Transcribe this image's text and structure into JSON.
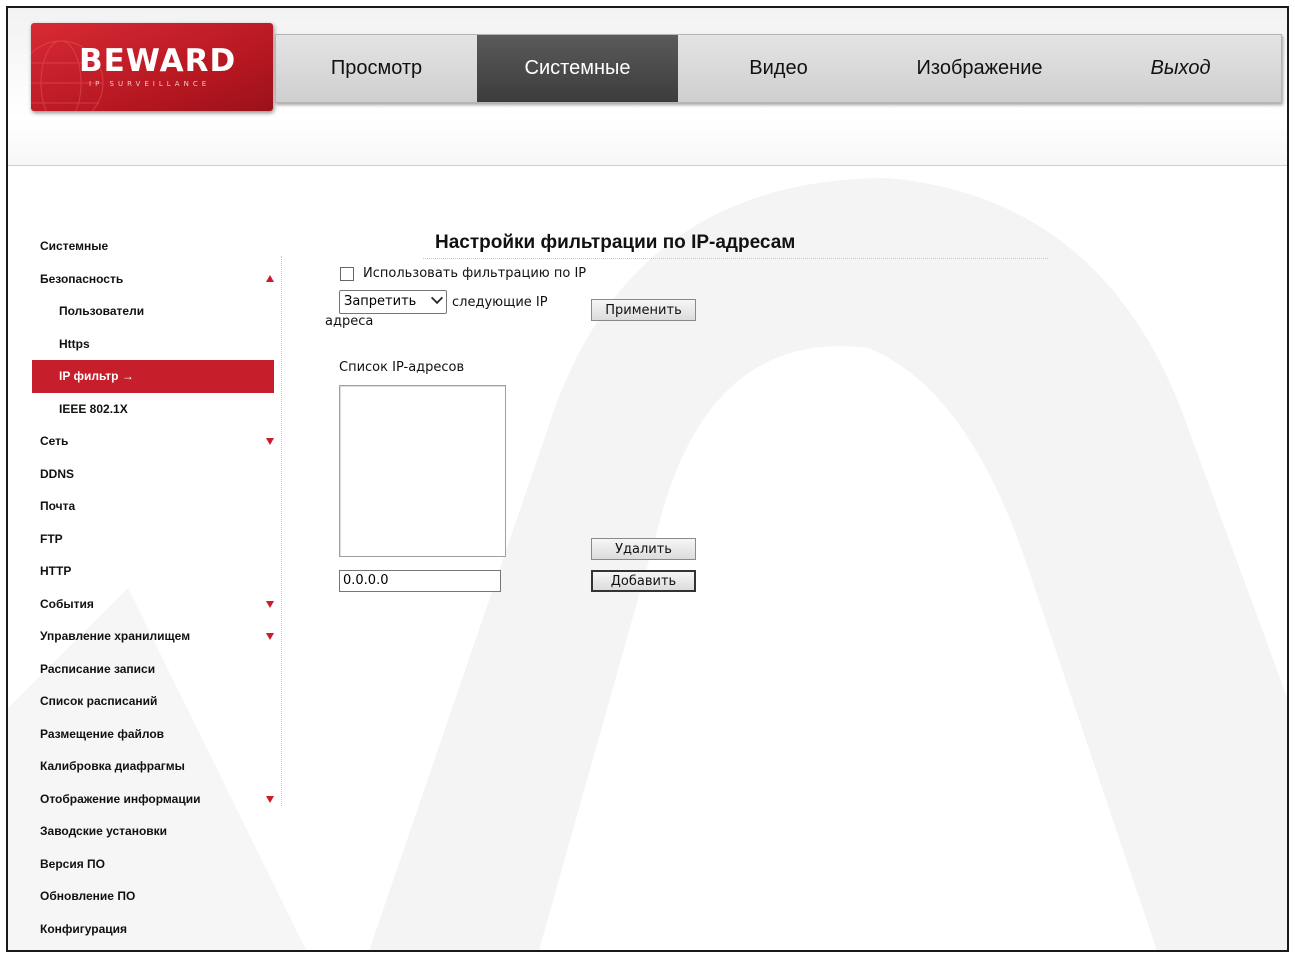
{
  "brand": {
    "name": "BEWARD",
    "tagline": "IP SURVEILLANCE"
  },
  "topnav": {
    "tabs": [
      {
        "label": "Просмотр",
        "active": false
      },
      {
        "label": "Системные",
        "active": true
      },
      {
        "label": "Видео",
        "active": false
      },
      {
        "label": "Изображение",
        "active": false
      },
      {
        "label": "Выход",
        "active": false
      }
    ]
  },
  "sidebar": {
    "items": [
      {
        "label": "Системные",
        "sub": false,
        "arrow": null,
        "active": false
      },
      {
        "label": "Безопасность",
        "sub": false,
        "arrow": "up",
        "active": false
      },
      {
        "label": "Пользователи",
        "sub": true,
        "arrow": null,
        "active": false
      },
      {
        "label": "Https",
        "sub": true,
        "arrow": null,
        "active": false
      },
      {
        "label": "IP фильтр →",
        "sub": true,
        "arrow": null,
        "active": true
      },
      {
        "label": "IEEE 802.1X",
        "sub": true,
        "arrow": null,
        "active": false
      },
      {
        "label": "Сеть",
        "sub": false,
        "arrow": "down",
        "active": false
      },
      {
        "label": "DDNS",
        "sub": false,
        "arrow": null,
        "active": false
      },
      {
        "label": "Почта",
        "sub": false,
        "arrow": null,
        "active": false
      },
      {
        "label": "FTP",
        "sub": false,
        "arrow": null,
        "active": false
      },
      {
        "label": "HTTP",
        "sub": false,
        "arrow": null,
        "active": false
      },
      {
        "label": "События",
        "sub": false,
        "arrow": "down",
        "active": false
      },
      {
        "label": "Управление хранилищем",
        "sub": false,
        "arrow": "down",
        "active": false
      },
      {
        "label": "Расписание записи",
        "sub": false,
        "arrow": null,
        "active": false
      },
      {
        "label": "Список расписаний",
        "sub": false,
        "arrow": null,
        "active": false
      },
      {
        "label": "Размещение файлов",
        "sub": false,
        "arrow": null,
        "active": false
      },
      {
        "label": "Калибровка диафрагмы",
        "sub": false,
        "arrow": null,
        "active": false
      },
      {
        "label": "Отображение информации",
        "sub": false,
        "arrow": "down",
        "active": false
      },
      {
        "label": "Заводские установки",
        "sub": false,
        "arrow": null,
        "active": false
      },
      {
        "label": "Версия ПО",
        "sub": false,
        "arrow": null,
        "active": false
      },
      {
        "label": "Обновление ПО",
        "sub": false,
        "arrow": null,
        "active": false
      },
      {
        "label": "Конфигурация",
        "sub": false,
        "arrow": null,
        "active": false
      }
    ]
  },
  "main": {
    "title": "Настройки фильтрации по IP-адресам",
    "use_filter_label": "Использовать фильтрацию по IP",
    "use_filter_checked": false,
    "mode_select_value": "Запретить",
    "following_label_1": "следующие IP",
    "following_label_2": "адреса",
    "apply_button": "Применить",
    "list_label": "Список IP-адресов",
    "ip_list": [],
    "delete_button": "Удалить",
    "ip_input_value": "0.0.0.0",
    "add_button": "Добавить"
  },
  "colors": {
    "accent": "#c71e2b",
    "active_tab": "#474747"
  }
}
